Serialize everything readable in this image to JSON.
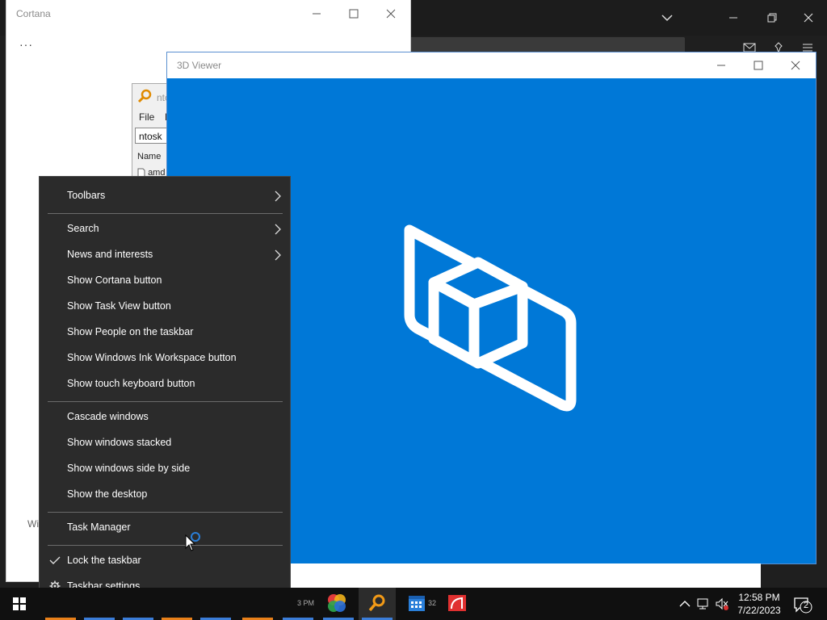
{
  "cortana": {
    "title": "Cortana",
    "more": "···",
    "bottom_text": "Wi"
  },
  "search_window": {
    "title": "nto",
    "menu_file": "File",
    "menu_e": "E",
    "query": "ntosk",
    "column_name": "Name",
    "first_file": "amd"
  },
  "viewer": {
    "title": "3D Viewer",
    "bg_color": "#0078d7"
  },
  "context_menu": {
    "items": [
      {
        "label": "Toolbars",
        "submenu": true
      },
      {
        "label": "Search",
        "submenu": true
      },
      {
        "label": "News and interests",
        "submenu": true
      },
      {
        "label": "Show Cortana button"
      },
      {
        "label": "Show Task View button"
      },
      {
        "label": "Show People on the taskbar"
      },
      {
        "label": "Show Windows Ink Workspace button"
      },
      {
        "label": "Show touch keyboard button"
      },
      {
        "label": "Cascade windows"
      },
      {
        "label": "Show windows stacked"
      },
      {
        "label": "Show windows side by side"
      },
      {
        "label": "Show the desktop"
      },
      {
        "label": "Task Manager"
      },
      {
        "label": "Lock the taskbar",
        "checked": true
      },
      {
        "label": "Taskbar settings",
        "icon": "gear-icon"
      }
    ]
  },
  "taskbar": {
    "time": "12:58 PM",
    "date": "7/22/2023",
    "notification_count": "2",
    "hidden_label_1": "3 PM",
    "hidden_label_2": "32"
  }
}
